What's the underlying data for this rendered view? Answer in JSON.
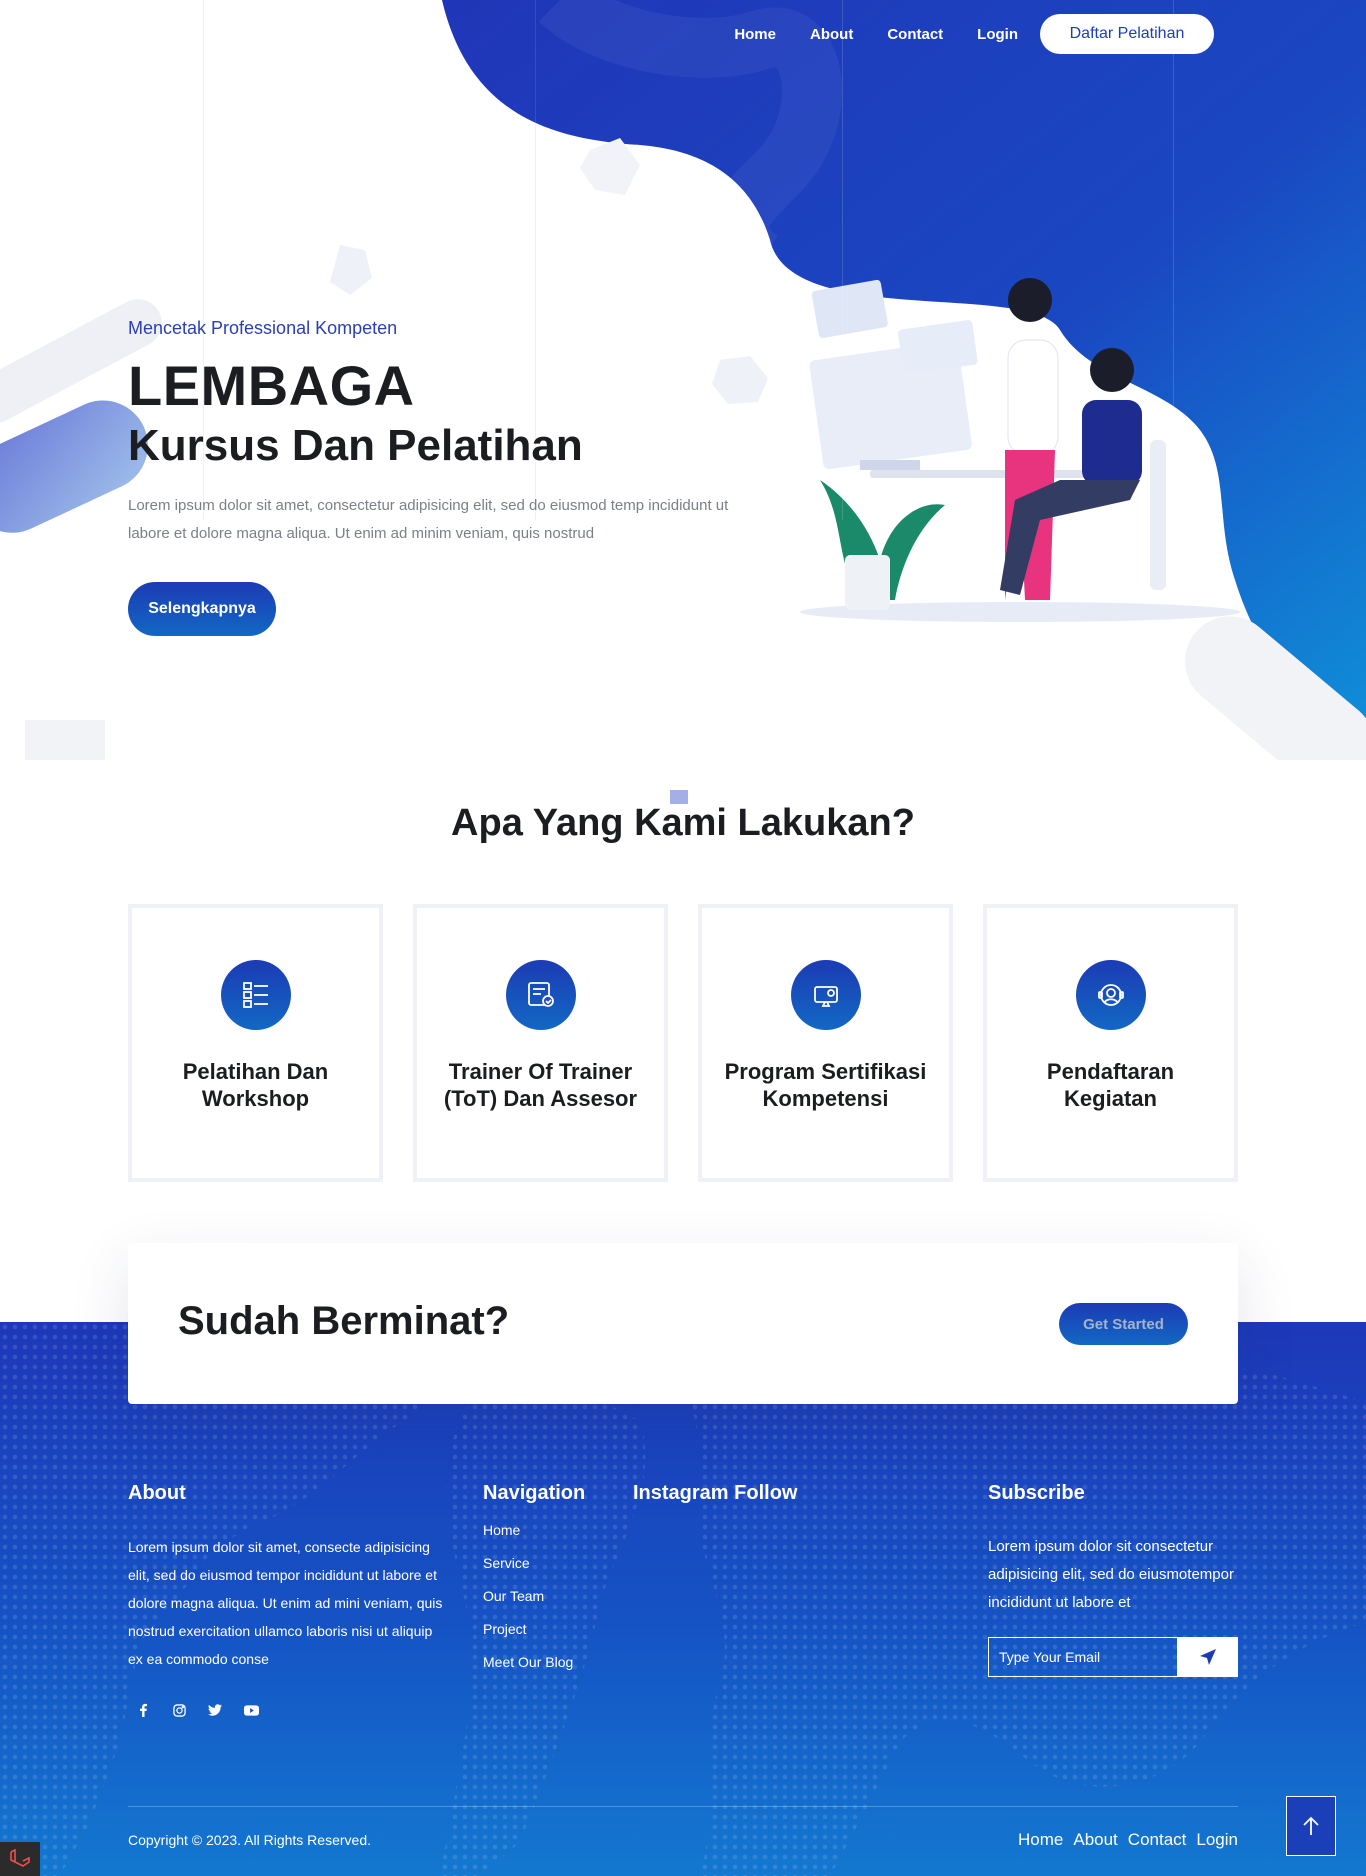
{
  "nav": {
    "items": [
      "Home",
      "About",
      "Contact",
      "Login"
    ],
    "cta_label": "Daftar Pelatihan"
  },
  "hero": {
    "subtitle": "Mencetak Professional Kompeten",
    "title": "LEMBAGA",
    "title2": "Kursus Dan Pelatihan",
    "text": "Lorem ipsum dolor sit amet, consectetur adipisicing elit, sed do eiusmod temp incididunt ut labore et dolore magna aliqua. Ut enim ad minim veniam, quis nostrud",
    "button": "Selengkapnya"
  },
  "services": {
    "title": "Apa Yang Kami Lakukan?",
    "cards": [
      {
        "title": "Pelatihan Dan Workshop",
        "icon": "list-icon"
      },
      {
        "title": "Trainer Of Trainer (ToT) Dan Assesor",
        "icon": "certificate-icon"
      },
      {
        "title": "Program Sertifikasi Kompetensi",
        "icon": "monitor-icon"
      },
      {
        "title": "Pendaftaran Kegiatan",
        "icon": "support-icon"
      }
    ]
  },
  "cta": {
    "title": "Sudah Berminat?",
    "button": "Get Started"
  },
  "footer": {
    "about": {
      "heading": "About",
      "text": "Lorem ipsum dolor sit amet, consecte adipisicing elit, sed do eiusmod tempor incididunt ut labore et dolore magna aliqua. Ut enim ad mini veniam, quis nostrud exercitation ullamco laboris nisi ut aliquip ex ea commodo conse",
      "social": [
        "facebook-icon",
        "instagram-icon",
        "twitter-icon",
        "youtube-icon"
      ]
    },
    "navigation": {
      "heading": "Navigation",
      "items": [
        "Home",
        "Service",
        "Our Team",
        "Project",
        "Meet Our Blog"
      ]
    },
    "instagram": {
      "heading": "Instagram Follow"
    },
    "subscribe": {
      "heading": "Subscribe",
      "text": "Lorem ipsum dolor sit consectetur adipisicing elit, sed do eiusmotempor incididunt ut labore et",
      "placeholder": "Type Your Email"
    },
    "copyright": "Copyright © 2023. All Rights Reserved.",
    "bottom_nav": [
      "Home",
      "About",
      "Contact",
      "Login"
    ]
  },
  "colors": {
    "brand_blue": "#1c3bb4",
    "brand_light_blue": "#1378d0"
  }
}
